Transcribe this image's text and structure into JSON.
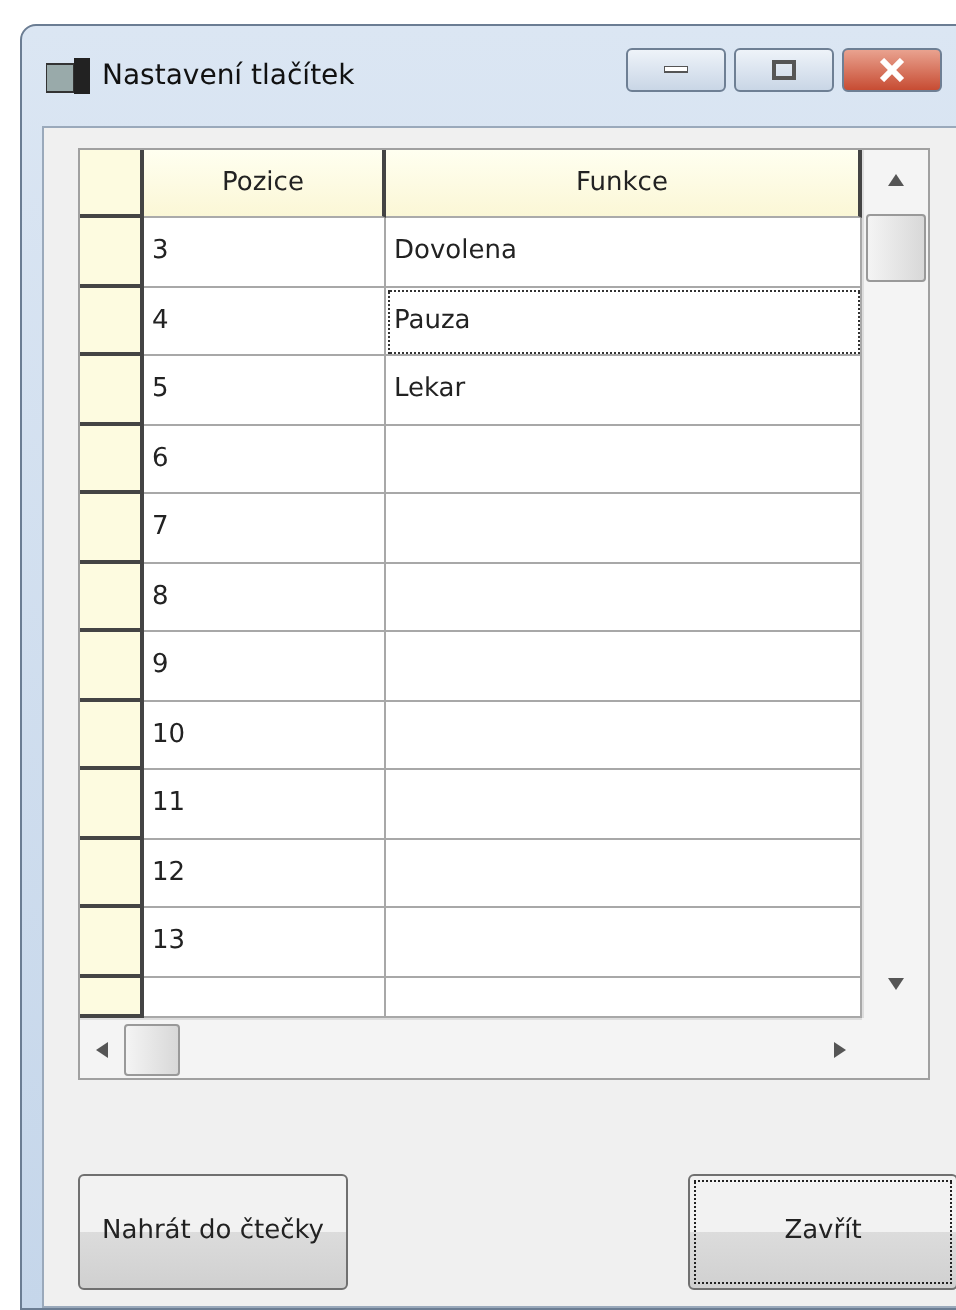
{
  "window": {
    "title": "Nastavení tlačítek"
  },
  "table": {
    "columns": [
      "Pozice",
      "Funkce"
    ],
    "rows": [
      {
        "pozice": "3",
        "funkce": "Dovolena",
        "focused": false
      },
      {
        "pozice": "4",
        "funkce": "Pauza",
        "focused": true
      },
      {
        "pozice": "5",
        "funkce": "Lekar",
        "focused": false
      },
      {
        "pozice": "6",
        "focused": false
      },
      {
        "pozice": "7",
        "focused": false
      },
      {
        "pozice": "8",
        "focused": false
      },
      {
        "pozice": "9",
        "focused": false
      },
      {
        "pozice": "10",
        "focused": false
      },
      {
        "pozice": "11",
        "focused": false
      },
      {
        "pozice": "12",
        "focused": false
      },
      {
        "pozice": "13",
        "focused": false
      }
    ]
  },
  "buttons": [
    {
      "label": "Nahrát do čtečky",
      "default": false
    },
    {
      "label": "Zavřít",
      "default": true
    }
  ]
}
